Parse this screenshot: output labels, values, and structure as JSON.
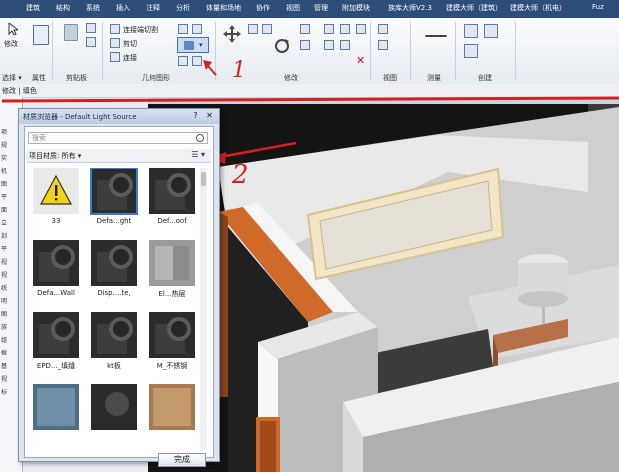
{
  "ribbon_tabs": [
    "建筑",
    "结构",
    "系统",
    "插入",
    "注释",
    "分析",
    "体量和场地",
    "协作",
    "视图",
    "管理",
    "附加模块",
    "族库大师V2.3",
    "建模大师（建筑）",
    "建模大师（机电）",
    "Fuz"
  ],
  "ribbon": {
    "modify_label": "修改",
    "connect_cut": "连接端切割",
    "cut": "剪切",
    "join": "连接",
    "panels": [
      "选择 ▾",
      "属性",
      "剪贴板",
      "几何图形",
      "修改",
      "视图",
      "测量",
      "创建"
    ]
  },
  "options_bar": {
    "text": "修改 | 填色"
  },
  "left_strip": {
    "items": [
      "项",
      "规",
      "实",
      "机",
      "图",
      "平",
      "面",
      "立",
      "剖",
      "平",
      "视",
      "视",
      "统",
      "明",
      "图",
      "族",
      "组",
      "框",
      "基",
      "视",
      "标"
    ]
  },
  "dialog": {
    "title": "材质浏览器 - Default Light Source",
    "help": "?",
    "close": "✕",
    "search_placeholder": "搜索",
    "library_filter": "项目材质: 所有 ▾",
    "view_toggle": "☰ ▾",
    "done": "完成",
    "materials": [
      {
        "label": "33",
        "kind": "warning"
      },
      {
        "label": "Defa...ght",
        "kind": "cylinder-dark",
        "selected": true
      },
      {
        "label": "Def...oof",
        "kind": "cylinder-dark"
      },
      {
        "label": "Defa...Wall",
        "kind": "cylinder-dark"
      },
      {
        "label": "Disp....te,",
        "kind": "cylinder-dark"
      },
      {
        "label": "El...热层",
        "kind": "gray-box"
      },
      {
        "label": "EPD..._填缝",
        "kind": "cylinder-dark"
      },
      {
        "label": "kt板",
        "kind": "cylinder-dark"
      },
      {
        "label": "M_不锈钢",
        "kind": "cylinder-dark"
      },
      {
        "label": "",
        "kind": "blue-tile"
      },
      {
        "label": "",
        "kind": "dark-tile"
      },
      {
        "label": "",
        "kind": "wood-tile"
      }
    ]
  },
  "annotations": [
    "1",
    "2"
  ]
}
